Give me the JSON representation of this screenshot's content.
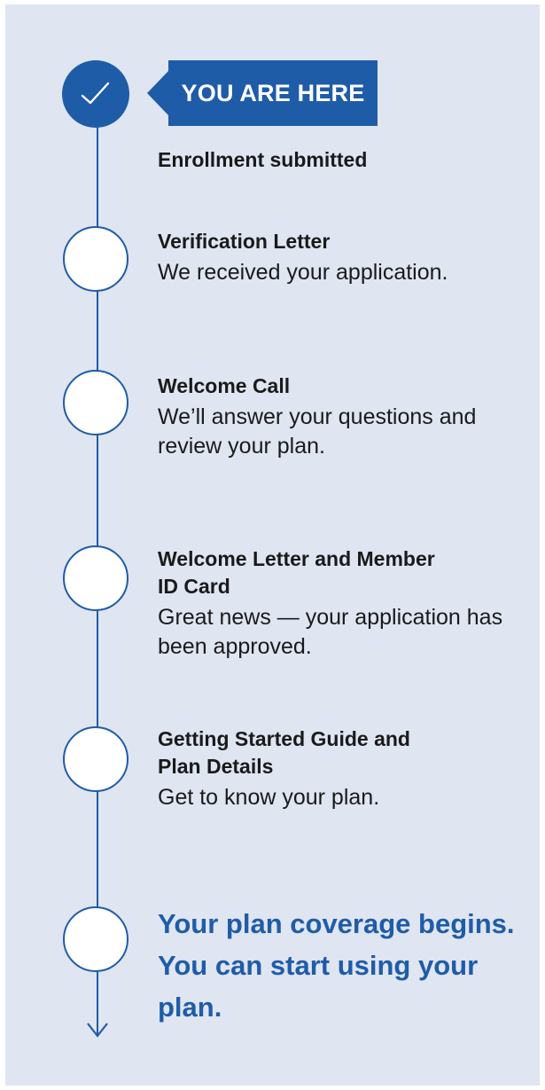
{
  "current_marker": {
    "label": "YOU ARE HERE",
    "icon": "checkmark-icon"
  },
  "steps": [
    {
      "title": "Enrollment submitted",
      "description": ""
    },
    {
      "title": "Verification Letter",
      "description": "We received your application."
    },
    {
      "title": "Welcome Call",
      "description": "We’ll answer your questions and review your plan."
    },
    {
      "title": "Welcome Letter and Member ID Card",
      "description": "Great news — your application has been approved."
    },
    {
      "title": "Getting Started Guide and Plan Details",
      "description": "Get to know your plan."
    }
  ],
  "final": {
    "text": "Your plan coverage begins. You can start using your plan."
  },
  "colors": {
    "accent": "#1f5ca8",
    "panel_background": "#dfe5f1",
    "node_fill": "#ffffff",
    "text": "#1a1a1a"
  }
}
